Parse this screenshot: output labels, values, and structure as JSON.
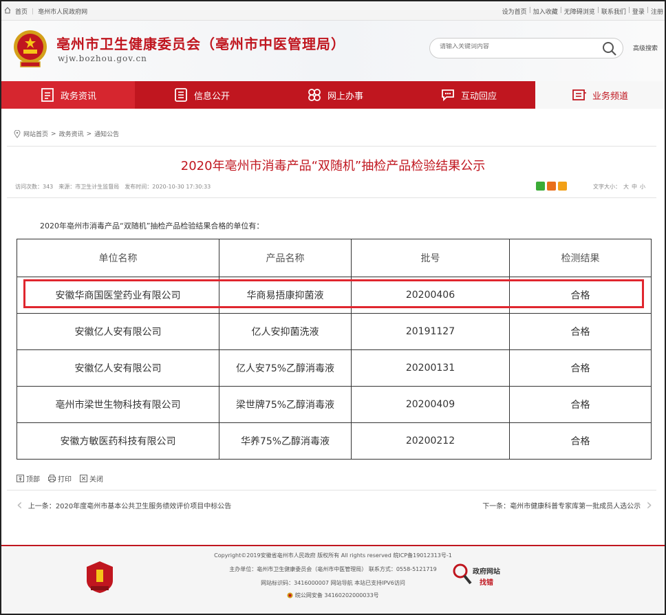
{
  "topbar": {
    "home": "首页",
    "gov_name": "亳州市人民政府网",
    "links": [
      "设为首页",
      "加入收藏",
      "无障碍浏览",
      "联系我们",
      "登录",
      "注册"
    ]
  },
  "header": {
    "title": "亳州市卫生健康委员会（亳州市中医管理局）",
    "url": "wjw.bozhou.gov.cn",
    "search_placeholder": "请输入关键词内容",
    "advanced_search": "高级搜索"
  },
  "nav": {
    "items": [
      {
        "label": "政务资讯",
        "icon": "document-icon"
      },
      {
        "label": "信息公开",
        "icon": "list-icon"
      },
      {
        "label": "网上办事",
        "icon": "grid-icon"
      },
      {
        "label": "互动回应",
        "icon": "chat-icon"
      },
      {
        "label": "业务频道",
        "icon": "channel-icon"
      }
    ]
  },
  "breadcrumb": {
    "items": [
      "网站首页",
      "政务资讯",
      "通知公告"
    ],
    "separator": ">"
  },
  "article": {
    "title": "2020年亳州市消毒产品“双随机”抽检产品检验结果公示",
    "meta_views_label": "访问次数：",
    "meta_views": "343",
    "meta_source_label": "来源：",
    "meta_source": "市卫生计生监督局",
    "meta_date_label": "发布时间：",
    "meta_date": "2020-10-30 17:30:33",
    "fontsize_label": "文字大小：",
    "fontsize_options": [
      "大",
      "中",
      "小"
    ],
    "intro": "2020年亳州市消毒产品“双随机”抽检产品检验结果合格的单位有："
  },
  "table": {
    "headers": [
      "单位名称",
      "产品名称",
      "批号",
      "检测结果"
    ],
    "rows": [
      [
        "安徽华商国医堂药业有限公司",
        "华商易捂康抑菌液",
        "20200406",
        "合格"
      ],
      [
        "安徽亿人安有限公司",
        "亿人安抑菌洗液",
        "20191127",
        "合格"
      ],
      [
        "安徽亿人安有限公司",
        "亿人安75%乙醇消毒液",
        "20200131",
        "合格"
      ],
      [
        "亳州市梁世生物科技有限公司",
        "梁世牌75%乙醇消毒液",
        "20200409",
        "合格"
      ],
      [
        "安徽方敏医药科技有限公司",
        "华养75%乙醇消毒液",
        "20200212",
        "合格"
      ]
    ]
  },
  "tools": {
    "top": "顶部",
    "print": "打印",
    "close": "关闭"
  },
  "pager": {
    "prev_label": "上一条：",
    "prev_title": "2020年度亳州市基本公共卫生服务绩效评价项目中标公告",
    "next_label": "下一条：",
    "next_title": "亳州市健康科普专家库第一批成员人选公示"
  },
  "footer": {
    "copyright": "Copyright©2019安徽省亳州市人民政府 版权所有 All rights reserved 皖ICP备19012313号-1",
    "host": "主办单位：亳州市卫生健康委员会（亳州市中医管理局） 联系方式：0558-5121719",
    "site_id": "网站标识码：3416000007 网站导航 本站已支持IPV6访问",
    "police": "皖公网安备 34160202000033号",
    "gov_find_label": "政府网站",
    "gov_find_sub": "找错"
  },
  "colors": {
    "brand_red": "#c0161f",
    "highlight": "#e0262e"
  }
}
